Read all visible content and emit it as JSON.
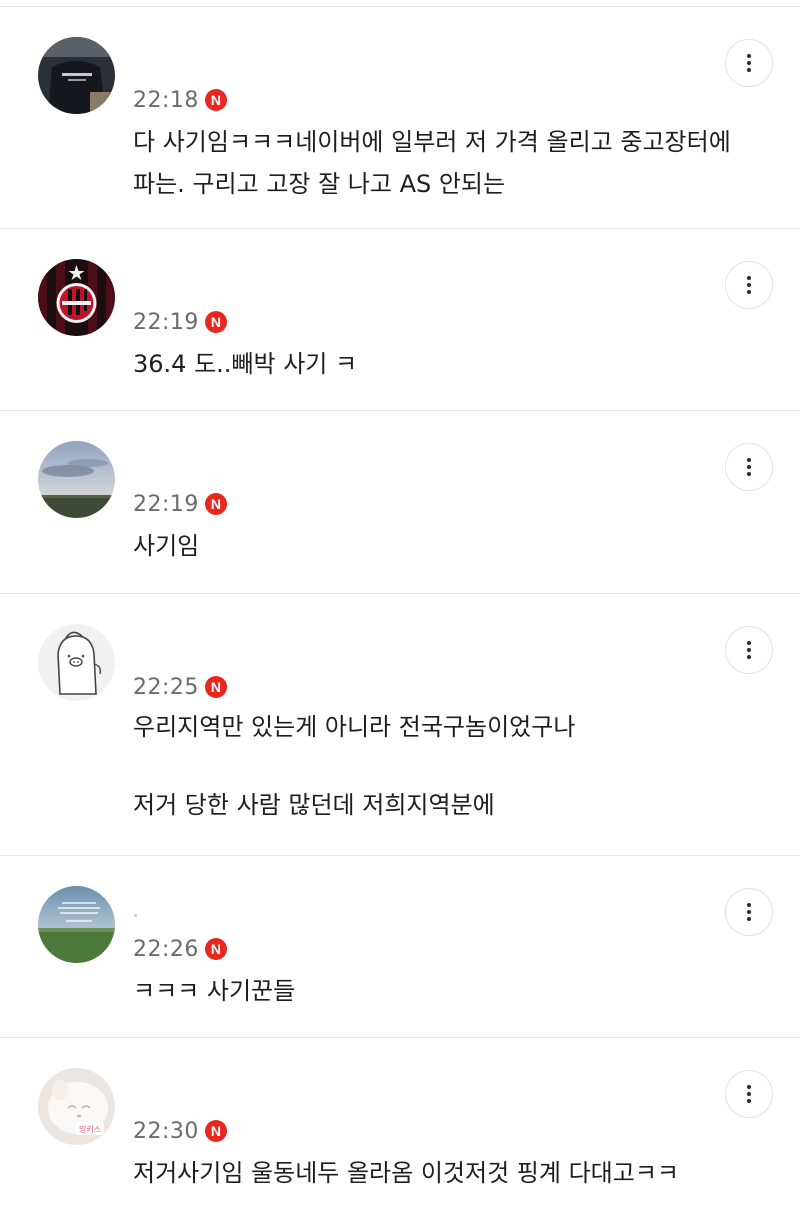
{
  "comments": [
    {
      "avatar": "avatar-dark-jacket",
      "nickname": "",
      "time": "22:18",
      "badge": "N",
      "text": "다 사기임ㅋㅋㅋ네이버에 일부러 저 가격 올리고 중고장터에\n파는. 구리고 고장 잘 나고 AS 안되는"
    },
    {
      "avatar": "avatar-ac-milan-crest",
      "nickname": "",
      "time": "22:19",
      "badge": "N",
      "text": "36.4 도..빼박 사기 ㅋ"
    },
    {
      "avatar": "avatar-sky-landscape",
      "nickname": "",
      "time": "22:19",
      "badge": "N",
      "text": "사기임"
    },
    {
      "avatar": "avatar-pig-cartoon",
      "nickname": "",
      "time": "22:25",
      "badge": "N",
      "text": "우리지역만 있는게 아니라 전국구놈이었구나\n\n저거 당한 사람 많던데 저희지역분에"
    },
    {
      "avatar": "avatar-green-field",
      "nickname": "",
      "time": "22:26",
      "badge": "N",
      "text": "ㅋㅋㅋ 사기꾼들"
    },
    {
      "avatar": "avatar-white-cat",
      "avatar_label": "밍키스",
      "nickname": "",
      "time": "22:30",
      "badge": "N",
      "text": "저거사기임 울동네두 올라옴 이것저것 핑계 다대고ㅋㅋ"
    }
  ],
  "colors": {
    "badge": "#e8271f",
    "time": "#6b6b6b",
    "text": "#1e1e1e",
    "divider": "#e6e6e6"
  },
  "icons": {
    "more": "more-vertical-icon",
    "badge": "naver-n-badge-icon"
  }
}
